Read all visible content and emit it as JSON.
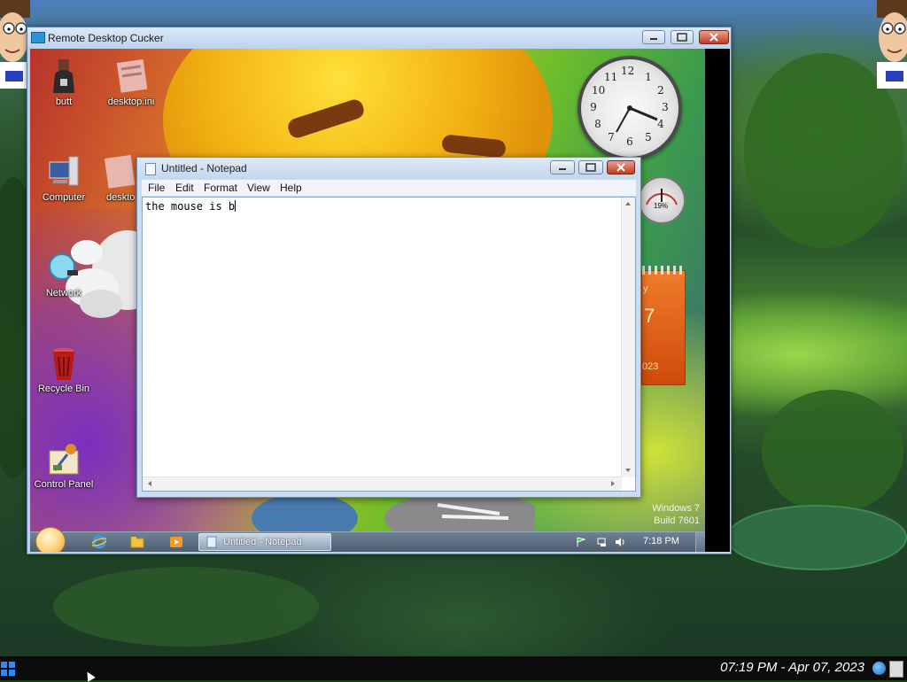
{
  "host": {
    "taskbar": {
      "clock": "07:19 PM - Apr 07, 2023"
    }
  },
  "rdp_window": {
    "title": "Remote Desktop Cucker",
    "controls": {
      "minimize": "minimize",
      "maximize": "maximize",
      "close": "close"
    }
  },
  "remote_desktop": {
    "icons": [
      {
        "label": "butt",
        "icon": "bottle-icon"
      },
      {
        "label": "desktop.ini",
        "icon": "settings-file-icon"
      },
      {
        "label": "Computer",
        "icon": "computer-icon"
      },
      {
        "label": "deskto",
        "icon": "settings-file-icon"
      },
      {
        "label": "Network",
        "icon": "network-icon"
      },
      {
        "label": "Recycle Bin",
        "icon": "recycle-bin-icon"
      },
      {
        "label": "Control Panel",
        "icon": "control-panel-icon"
      }
    ],
    "clock_numbers": [
      "12",
      "1",
      "2",
      "3",
      "4",
      "5",
      "6",
      "7",
      "8",
      "9",
      "10",
      "11"
    ],
    "cpu_gadget": {
      "value": "19%"
    },
    "calendar_gadget": {
      "day_fragment": "y",
      "date_fragment": "7",
      "year_fragment": "023"
    },
    "watermark": {
      "line1": "Windows 7",
      "line2": "Build 7601"
    },
    "taskbar": {
      "active_task": "Untitled - Notepad",
      "clock": "7:18 PM"
    }
  },
  "notepad": {
    "title": "Untitled - Notepad",
    "menu": [
      "File",
      "Edit",
      "Format",
      "View",
      "Help"
    ],
    "content": "the mouse is b"
  },
  "colors": {
    "host_taskbar": "#0b0b0b",
    "rdp_frame": "#b9d1ea",
    "notepad_frame": "#c9dcf0",
    "close_button": "#c23a20"
  }
}
